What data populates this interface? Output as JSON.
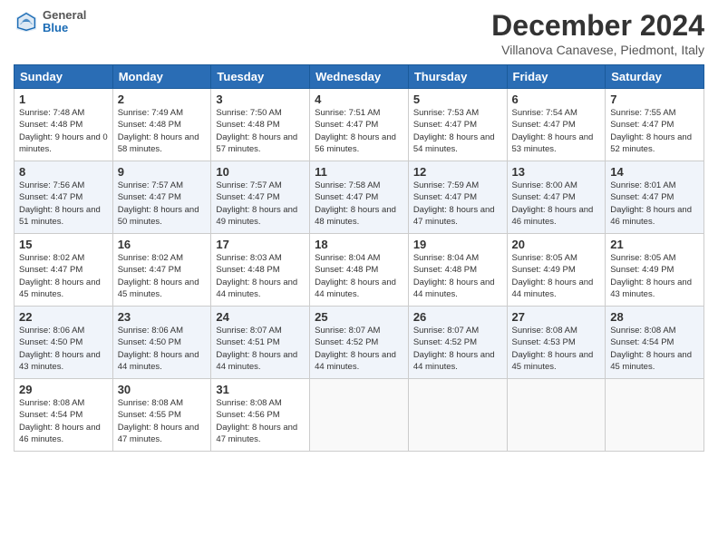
{
  "header": {
    "logo_general": "General",
    "logo_blue": "Blue",
    "title": "December 2024",
    "location": "Villanova Canavese, Piedmont, Italy"
  },
  "weekdays": [
    "Sunday",
    "Monday",
    "Tuesday",
    "Wednesday",
    "Thursday",
    "Friday",
    "Saturday"
  ],
  "weeks": [
    [
      {
        "day": "1",
        "sunrise": "7:48 AM",
        "sunset": "4:48 PM",
        "daylight": "9 hours and 0 minutes."
      },
      {
        "day": "2",
        "sunrise": "7:49 AM",
        "sunset": "4:48 PM",
        "daylight": "8 hours and 58 minutes."
      },
      {
        "day": "3",
        "sunrise": "7:50 AM",
        "sunset": "4:48 PM",
        "daylight": "8 hours and 57 minutes."
      },
      {
        "day": "4",
        "sunrise": "7:51 AM",
        "sunset": "4:47 PM",
        "daylight": "8 hours and 56 minutes."
      },
      {
        "day": "5",
        "sunrise": "7:53 AM",
        "sunset": "4:47 PM",
        "daylight": "8 hours and 54 minutes."
      },
      {
        "day": "6",
        "sunrise": "7:54 AM",
        "sunset": "4:47 PM",
        "daylight": "8 hours and 53 minutes."
      },
      {
        "day": "7",
        "sunrise": "7:55 AM",
        "sunset": "4:47 PM",
        "daylight": "8 hours and 52 minutes."
      }
    ],
    [
      {
        "day": "8",
        "sunrise": "7:56 AM",
        "sunset": "4:47 PM",
        "daylight": "8 hours and 51 minutes."
      },
      {
        "day": "9",
        "sunrise": "7:57 AM",
        "sunset": "4:47 PM",
        "daylight": "8 hours and 50 minutes."
      },
      {
        "day": "10",
        "sunrise": "7:57 AM",
        "sunset": "4:47 PM",
        "daylight": "8 hours and 49 minutes."
      },
      {
        "day": "11",
        "sunrise": "7:58 AM",
        "sunset": "4:47 PM",
        "daylight": "8 hours and 48 minutes."
      },
      {
        "day": "12",
        "sunrise": "7:59 AM",
        "sunset": "4:47 PM",
        "daylight": "8 hours and 47 minutes."
      },
      {
        "day": "13",
        "sunrise": "8:00 AM",
        "sunset": "4:47 PM",
        "daylight": "8 hours and 46 minutes."
      },
      {
        "day": "14",
        "sunrise": "8:01 AM",
        "sunset": "4:47 PM",
        "daylight": "8 hours and 46 minutes."
      }
    ],
    [
      {
        "day": "15",
        "sunrise": "8:02 AM",
        "sunset": "4:47 PM",
        "daylight": "8 hours and 45 minutes."
      },
      {
        "day": "16",
        "sunrise": "8:02 AM",
        "sunset": "4:47 PM",
        "daylight": "8 hours and 45 minutes."
      },
      {
        "day": "17",
        "sunrise": "8:03 AM",
        "sunset": "4:48 PM",
        "daylight": "8 hours and 44 minutes."
      },
      {
        "day": "18",
        "sunrise": "8:04 AM",
        "sunset": "4:48 PM",
        "daylight": "8 hours and 44 minutes."
      },
      {
        "day": "19",
        "sunrise": "8:04 AM",
        "sunset": "4:48 PM",
        "daylight": "8 hours and 44 minutes."
      },
      {
        "day": "20",
        "sunrise": "8:05 AM",
        "sunset": "4:49 PM",
        "daylight": "8 hours and 44 minutes."
      },
      {
        "day": "21",
        "sunrise": "8:05 AM",
        "sunset": "4:49 PM",
        "daylight": "8 hours and 43 minutes."
      }
    ],
    [
      {
        "day": "22",
        "sunrise": "8:06 AM",
        "sunset": "4:50 PM",
        "daylight": "8 hours and 43 minutes."
      },
      {
        "day": "23",
        "sunrise": "8:06 AM",
        "sunset": "4:50 PM",
        "daylight": "8 hours and 44 minutes."
      },
      {
        "day": "24",
        "sunrise": "8:07 AM",
        "sunset": "4:51 PM",
        "daylight": "8 hours and 44 minutes."
      },
      {
        "day": "25",
        "sunrise": "8:07 AM",
        "sunset": "4:52 PM",
        "daylight": "8 hours and 44 minutes."
      },
      {
        "day": "26",
        "sunrise": "8:07 AM",
        "sunset": "4:52 PM",
        "daylight": "8 hours and 44 minutes."
      },
      {
        "day": "27",
        "sunrise": "8:08 AM",
        "sunset": "4:53 PM",
        "daylight": "8 hours and 45 minutes."
      },
      {
        "day": "28",
        "sunrise": "8:08 AM",
        "sunset": "4:54 PM",
        "daylight": "8 hours and 45 minutes."
      }
    ],
    [
      {
        "day": "29",
        "sunrise": "8:08 AM",
        "sunset": "4:54 PM",
        "daylight": "8 hours and 46 minutes."
      },
      {
        "day": "30",
        "sunrise": "8:08 AM",
        "sunset": "4:55 PM",
        "daylight": "8 hours and 47 minutes."
      },
      {
        "day": "31",
        "sunrise": "8:08 AM",
        "sunset": "4:56 PM",
        "daylight": "8 hours and 47 minutes."
      },
      null,
      null,
      null,
      null
    ]
  ]
}
